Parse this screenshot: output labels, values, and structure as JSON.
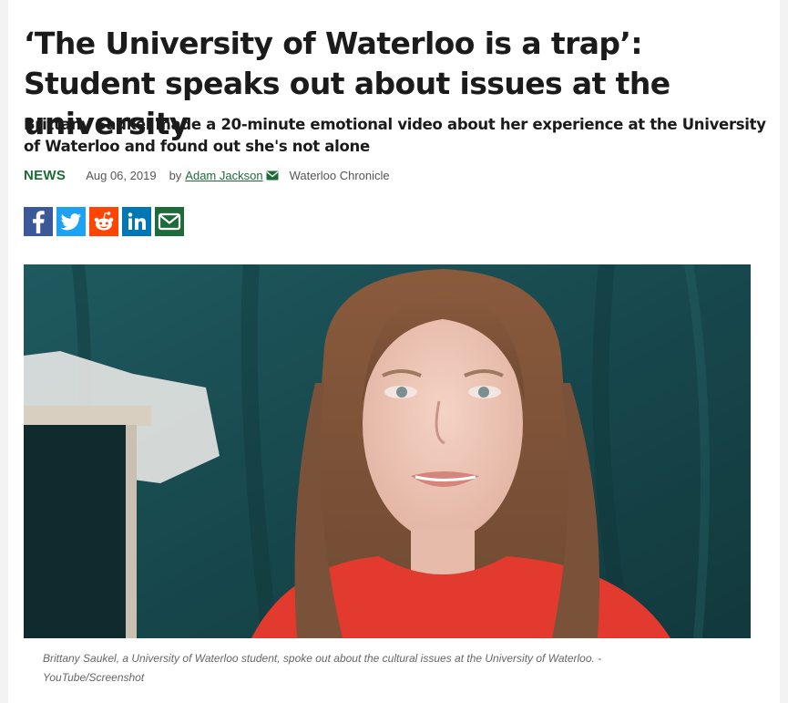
{
  "article": {
    "headline": "‘The University of Waterloo is a trap’: Student speaks out about issues at the university",
    "subheadline": "Brittany Saukel made a 20-minute emotional video about her experience at the University of Waterloo and found out she's not alone",
    "section": "NEWS",
    "date": "Aug 06, 2019",
    "by_label": "by",
    "author": "Adam Jackson",
    "publication": "Waterloo Chronicle",
    "caption": "Brittany Saukel, a University of Waterloo student, spoke out about the cultural issues at the University of Waterloo. - YouTube/Screenshot"
  },
  "share": [
    {
      "network": "facebook",
      "icon": "facebook-icon",
      "color": "#3b5998"
    },
    {
      "network": "twitter",
      "icon": "twitter-icon",
      "color": "#1da1f2"
    },
    {
      "network": "reddit",
      "icon": "reddit-icon",
      "color": "#ff4500"
    },
    {
      "network": "linkedin",
      "icon": "linkedin-icon",
      "color": "#0077b5"
    },
    {
      "network": "email",
      "icon": "email-icon",
      "color": "#1e6b3a"
    }
  ],
  "colors": {
    "accent_green": "#1e6b3a",
    "text": "#1b1b1b",
    "meta_text": "#555555"
  }
}
